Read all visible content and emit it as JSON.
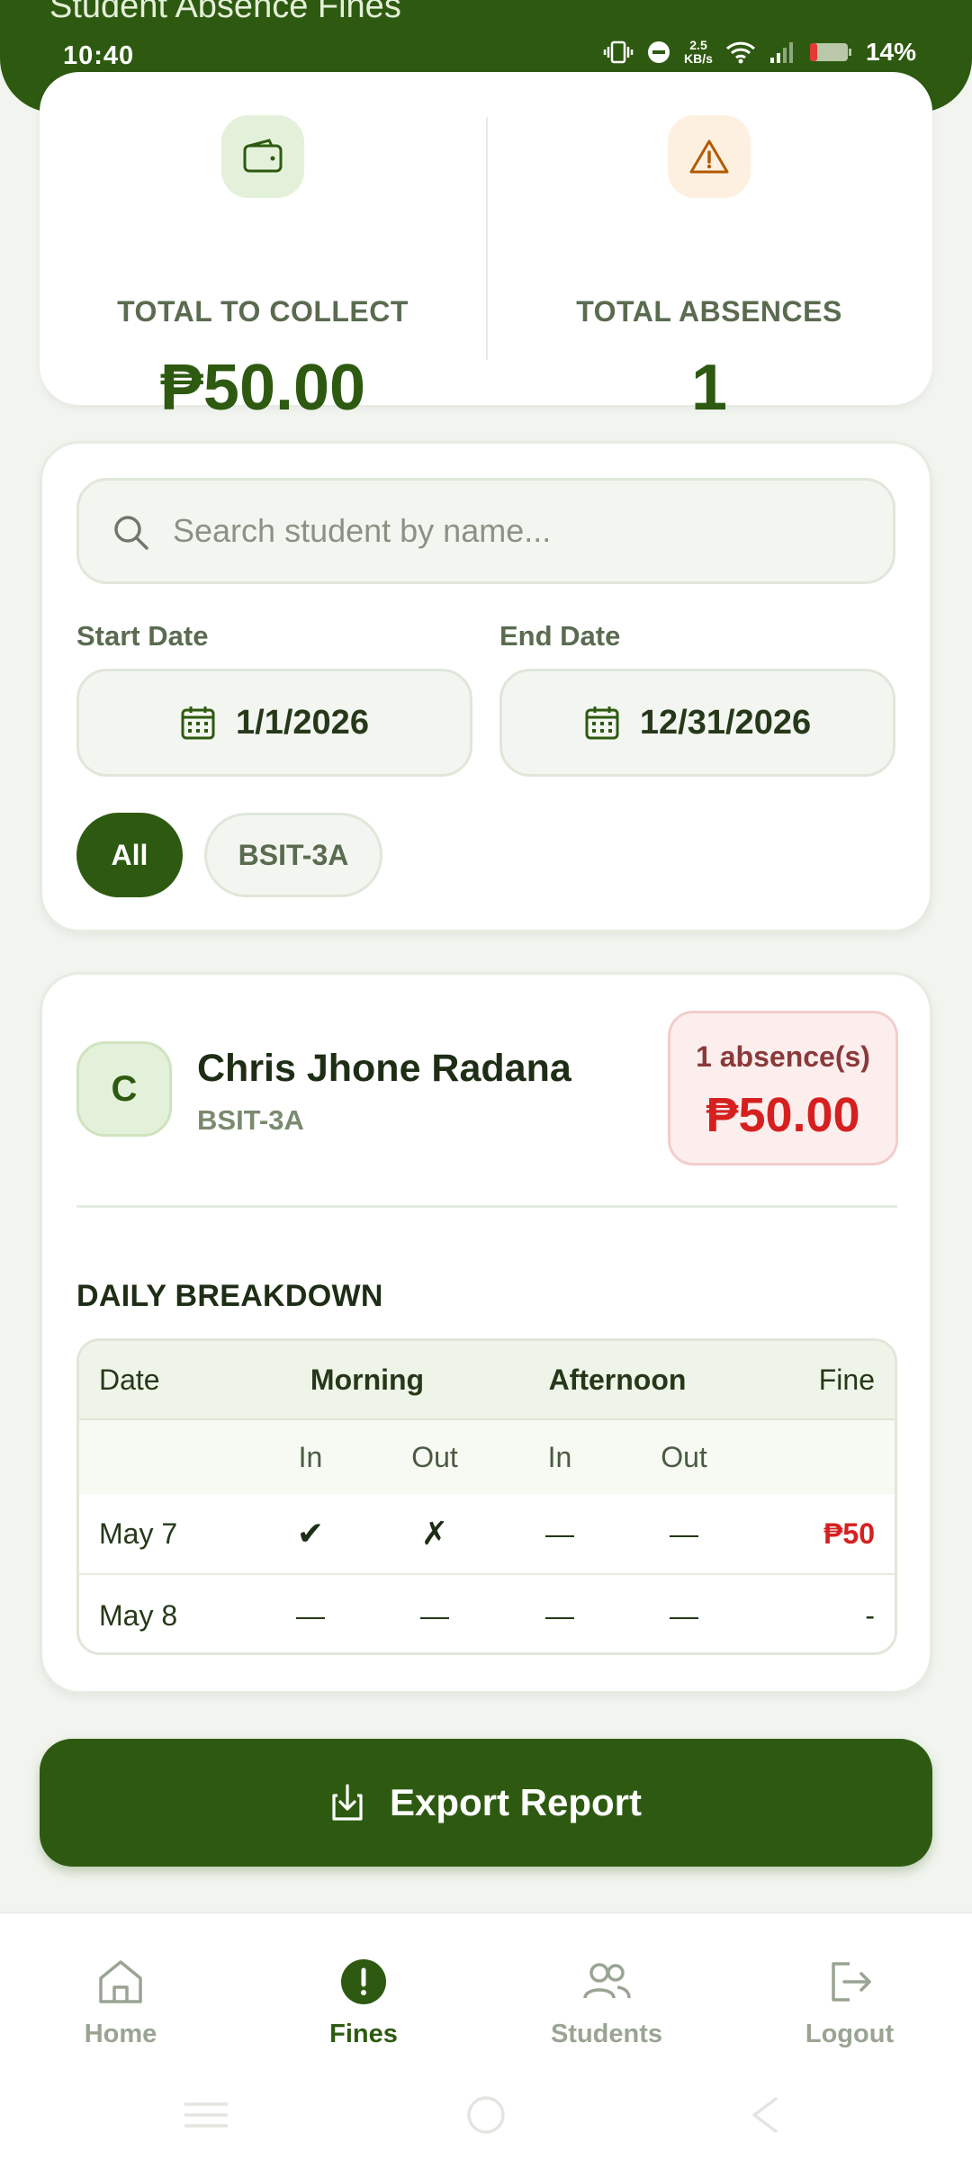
{
  "app": {
    "title": "Student Absence Fines"
  },
  "status_bar": {
    "time": "10:40",
    "net_speed_value": "2.5",
    "net_speed_unit": "KB/s",
    "battery": "14%"
  },
  "summary": {
    "collect_label": "TOTAL TO COLLECT",
    "collect_value": "₱50.00",
    "collect_icon": "wallet-icon",
    "absences_label": "TOTAL ABSENCES",
    "absences_value": "1",
    "absences_icon": "warning-icon"
  },
  "filters": {
    "search_placeholder": "Search student by name...",
    "search_value": "",
    "start_date_label": "Start Date",
    "start_date": "1/1/2026",
    "end_date_label": "End Date",
    "end_date": "12/31/2026",
    "chips": [
      {
        "label": "All",
        "selected": true
      },
      {
        "label": "BSIT-3A",
        "selected": false
      }
    ]
  },
  "student": {
    "initial": "C",
    "name": "Chris Jhone Radana",
    "section": "BSIT-3A",
    "absence_count": "1 absence(s)",
    "fine_total": "₱50.00",
    "breakdown_title": "DAILY BREAKDOWN",
    "table": {
      "headers": {
        "date": "Date",
        "morning": "Morning",
        "afternoon": "Afternoon",
        "fine": "Fine"
      },
      "subheaders": [
        "In",
        "Out",
        "In",
        "Out"
      ],
      "rows": [
        {
          "date": "May 7",
          "m_in": "✔",
          "m_out": "✗",
          "a_in": "—",
          "a_out": "—",
          "fine": "₱50"
        },
        {
          "date": "May 8",
          "m_in": "—",
          "m_out": "—",
          "a_in": "—",
          "a_out": "—",
          "fine": "-"
        }
      ]
    }
  },
  "export_button": {
    "label": "Export Report",
    "icon": "download-icon"
  },
  "bottom_nav": [
    {
      "label": "Home",
      "icon": "home-icon",
      "active": false
    },
    {
      "label": "Fines",
      "icon": "alert-circle-icon",
      "active": true
    },
    {
      "label": "Students",
      "icon": "users-icon",
      "active": false
    },
    {
      "label": "Logout",
      "icon": "logout-icon",
      "active": false
    }
  ],
  "colors": {
    "primary": "#2d5a10",
    "danger": "#d62020",
    "background": "#f2f5ef"
  }
}
